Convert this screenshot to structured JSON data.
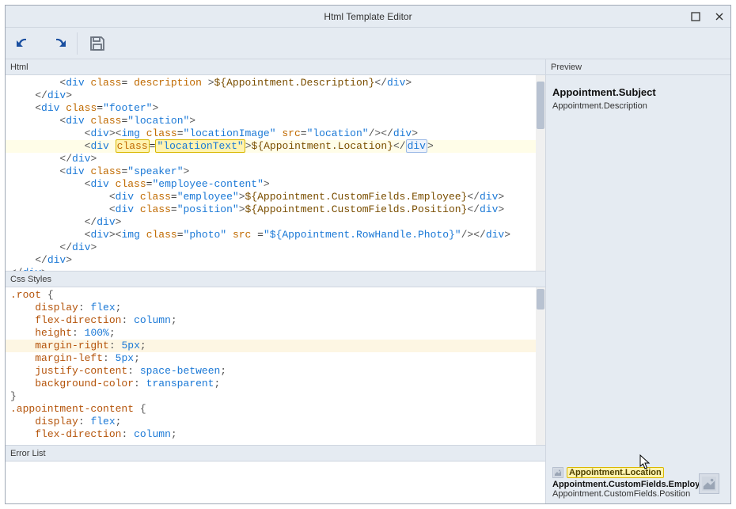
{
  "window": {
    "title": "Html Template Editor"
  },
  "sections": {
    "html": "Html",
    "css": "Css Styles",
    "errors": "Error List",
    "preview": "Preview"
  },
  "html_code": {
    "lines": [
      {
        "indent": 2,
        "kind": "open",
        "tag": "div",
        "attrs": [
          [
            "class",
            "description"
          ]
        ],
        "text_expr": "${Appointment.Description}",
        "close_inline": true,
        "broken_open": true
      },
      {
        "indent": 1,
        "kind": "close",
        "tag": "div"
      },
      {
        "indent": 1,
        "kind": "open",
        "tag": "div",
        "attrs": [
          [
            "class",
            "footer"
          ]
        ]
      },
      {
        "indent": 2,
        "kind": "open",
        "tag": "div",
        "attrs": [
          [
            "class",
            "location"
          ]
        ]
      },
      {
        "indent": 3,
        "kind": "open",
        "tag": "div",
        "attrs": [],
        "inner_img": {
          "attrs": [
            [
              "class",
              "locationImage"
            ],
            [
              "src",
              "location"
            ]
          ]
        },
        "close_inline": true
      },
      {
        "indent": 3,
        "kind": "open",
        "tag": "div",
        "attrs": [
          [
            "class",
            "locationText"
          ]
        ],
        "text_expr": "${Appointment.Location}",
        "close_inline": true,
        "highlight": true
      },
      {
        "indent": 2,
        "kind": "close",
        "tag": "div"
      },
      {
        "indent": 2,
        "kind": "open",
        "tag": "div",
        "attrs": [
          [
            "class",
            "speaker"
          ]
        ]
      },
      {
        "indent": 3,
        "kind": "open",
        "tag": "div",
        "attrs": [
          [
            "class",
            "employee-content"
          ]
        ]
      },
      {
        "indent": 4,
        "kind": "open",
        "tag": "div",
        "attrs": [
          [
            "class",
            "employee"
          ]
        ],
        "text_expr": "${Appointment.CustomFields.Employee}",
        "close_inline": true
      },
      {
        "indent": 4,
        "kind": "open",
        "tag": "div",
        "attrs": [
          [
            "class",
            "position"
          ]
        ],
        "text_expr": "${Appointment.CustomFields.Position}",
        "close_inline": true
      },
      {
        "indent": 3,
        "kind": "close",
        "tag": "div"
      },
      {
        "indent": 3,
        "kind": "open",
        "tag": "div",
        "attrs": [],
        "inner_img": {
          "attrs": [
            [
              "class",
              "photo"
            ],
            [
              "src ",
              "${Appointment.RowHandle.Photo}"
            ]
          ]
        },
        "close_inline": true
      },
      {
        "indent": 2,
        "kind": "close",
        "tag": "div"
      },
      {
        "indent": 1,
        "kind": "close",
        "tag": "div"
      },
      {
        "indent": 0,
        "kind": "close",
        "tag": "div"
      }
    ]
  },
  "css_code": {
    "blocks": [
      {
        "selector": ".root",
        "decls": [
          [
            "display",
            "flex"
          ],
          [
            "flex-direction",
            "column"
          ],
          [
            "height",
            "100%"
          ],
          [
            "margin-right",
            "5px"
          ],
          [
            "margin-left",
            "5px"
          ],
          [
            "justify-content",
            "space-between"
          ],
          [
            "background-color",
            "transparent"
          ]
        ],
        "hl_index": 3
      },
      {
        "selector": ".appointment-content",
        "decls": [
          [
            "display",
            "flex"
          ],
          [
            "flex-direction",
            "column"
          ]
        ],
        "truncated": true
      }
    ]
  },
  "preview": {
    "subject": "Appointment.Subject",
    "description": "Appointment.Description",
    "location": "Appointment.Location",
    "employee": "Appointment.CustomFields.Employee",
    "position": "Appointment.CustomFields.Position"
  }
}
